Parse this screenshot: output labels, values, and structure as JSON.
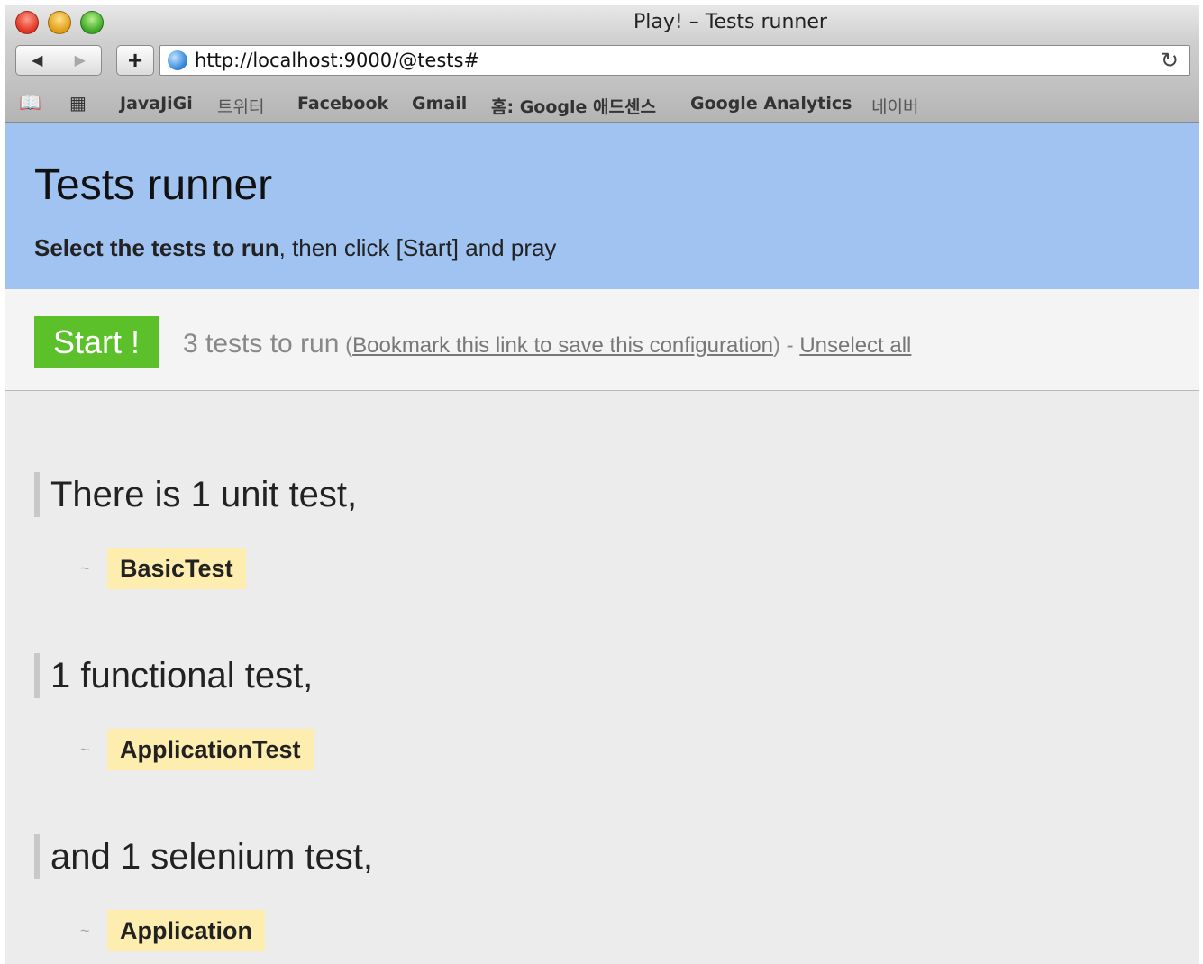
{
  "browser": {
    "window_title": "Play! – Tests runner",
    "url": "http://localhost:9000/@tests#",
    "bookmarks": [
      "JavaJiGi",
      "트위터",
      "Facebook",
      "Gmail",
      "홈: Google 애드센스",
      "Google Analytics",
      "네이버"
    ]
  },
  "header": {
    "title": "Tests runner",
    "subtitle_bold": "Select the tests to run",
    "subtitle_rest": ", then click [Start] and pray"
  },
  "runbar": {
    "start_label": "Start !",
    "count_text": "3 tests to run",
    "paren_open": " (",
    "bookmark_link": "Bookmark this link to save this configuration",
    "paren_close": ") - ",
    "unselect_link": "Unselect all"
  },
  "sections": [
    {
      "heading": "There is 1 unit test,",
      "tests": [
        "BasicTest"
      ]
    },
    {
      "heading": "1 functional test,",
      "tests": [
        "ApplicationTest"
      ]
    },
    {
      "heading": "and 1 selenium test,",
      "tests": [
        "Application"
      ]
    }
  ],
  "tilde": "~",
  "colors": {
    "header_bg": "#a1c3f2",
    "start_button": "#5cc02a",
    "test_highlight": "#fdeeb0"
  }
}
